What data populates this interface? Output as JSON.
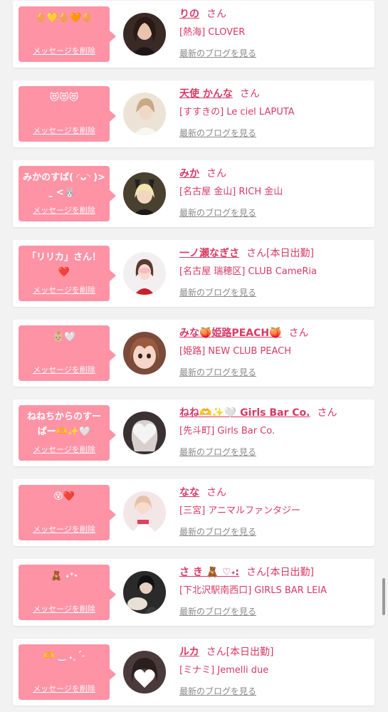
{
  "delete_label": "メッセージを削除",
  "blog_label": "最新のブログを見る",
  "colors": {
    "accent": "#d63a65",
    "bubble": "#ff93a6",
    "background": "#f2f2f2",
    "link_gray": "#8a8a8a"
  },
  "items": [
    {
      "message": "🥚💛🥚🧡🥚",
      "name": "りの",
      "honorific": "さん",
      "shop": "[熱海] CLOVER",
      "avatar_color": "#3a2a26"
    },
    {
      "message": "😻😻😻",
      "name": "天使 かんな",
      "honorific": "さん",
      "shop": "[すすきの] Le ciel LAPUTA",
      "avatar_color": "#e9ddcc"
    },
    {
      "message": "みかのすば(  ◜ᴗ◝ )>  ̫ <🐰",
      "name": "みか",
      "honorific": "さん",
      "shop": "[名古屋 金山] RICH 金山",
      "avatar_color": "#4a4030"
    },
    {
      "message": "「リリカ」さん！❤️",
      "name": "一ノ瀬なぎさ",
      "honorific": "さん[本日出勤]",
      "shop": "[名古屋 瑞穂区] CLUB CameRia",
      "avatar_color": "#f0e8ec"
    },
    {
      "message": "👶🏼🤍",
      "name": "みな🍑姫路PEACH🍑",
      "honorific": "さん",
      "shop": "[姫路] NEW CLUB PEACH",
      "avatar_color": "#7a4a3a"
    },
    {
      "message": "ねねちからのすーぱー🫶✨🤍",
      "name": "ねね🫶✨🤍 Girls Bar Co.",
      "honorific": "さん",
      "shop": "[先斗町] Girls Bar Co.",
      "avatar_color": "#3a3232"
    },
    {
      "message": "😵❤️",
      "name": "なな",
      "honorific": "さん",
      "shop": "[三宮] アニマルファンタジー",
      "avatar_color": "#efdede"
    },
    {
      "message": "🧸 ˖⁺‧",
      "name": "さ き 🧸 ♡˖:",
      "honorific": "さん[本日出勤]",
      "shop": "[下北沢駅南西口] GIRLS BAR LEIA",
      "avatar_color": "#2a2a2a"
    },
    {
      "message": "🫶 ‿ .ˎˊ˗",
      "name": "ルカ",
      "honorific": "さん[本日出勤]",
      "shop": "[ミナミ] Jemelli due",
      "avatar_color": "#4a3a3a"
    }
  ]
}
